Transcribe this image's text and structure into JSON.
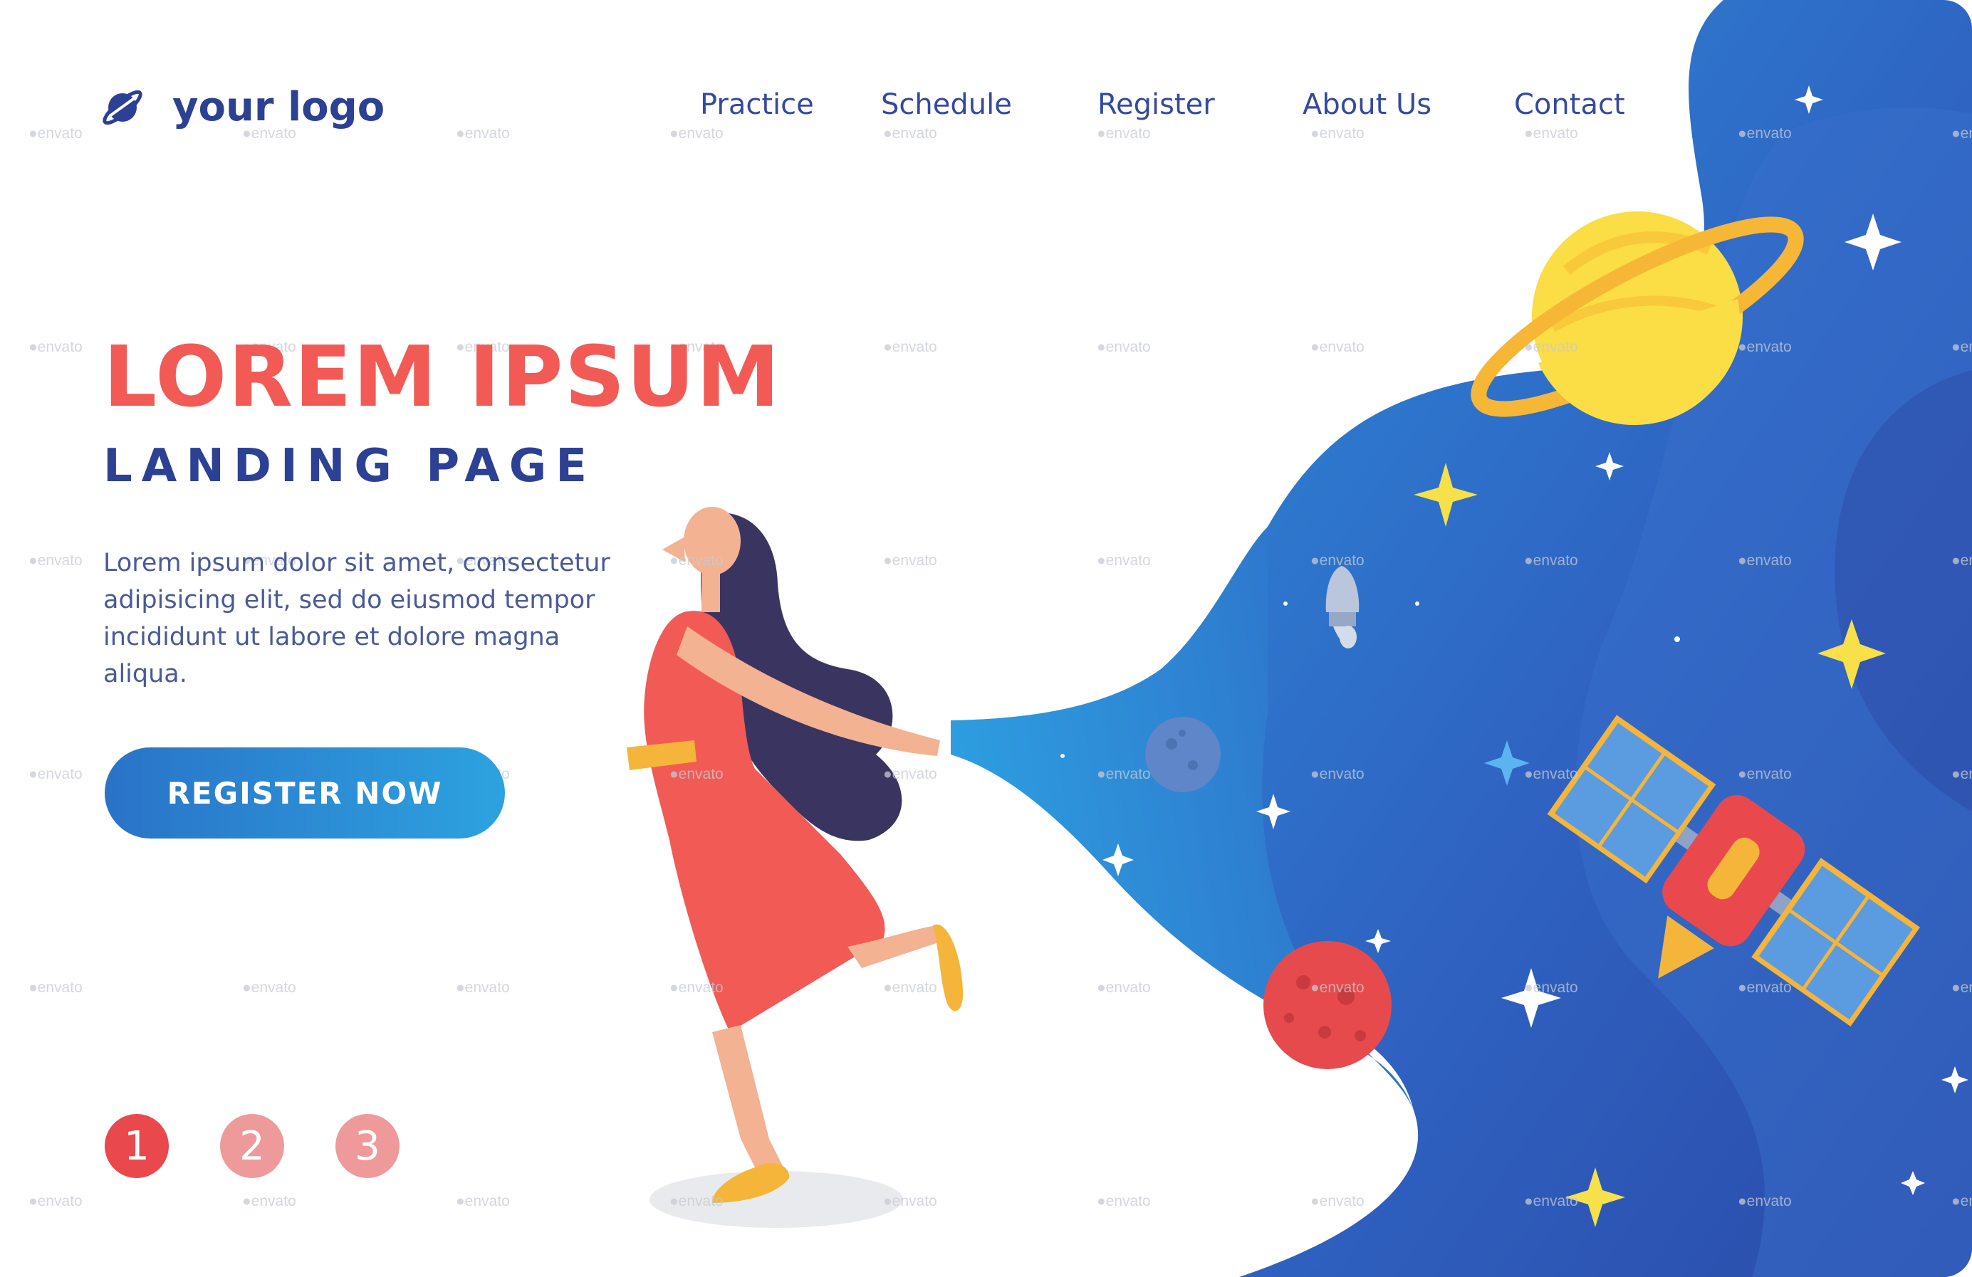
{
  "logo": {
    "text": "your logo",
    "icon": "planet-ring-icon"
  },
  "nav": {
    "items": [
      {
        "label": "Practice"
      },
      {
        "label": "Schedule"
      },
      {
        "label": "Register"
      },
      {
        "label": "About Us"
      },
      {
        "label": "Contact"
      }
    ]
  },
  "hero": {
    "title": "LOREM IPSUM",
    "subtitle": "LANDING PAGE",
    "body": "Lorem ipsum dolor sit amet, consectetur adipisicing elit, sed do eiusmod tempor incididunt ut labore et dolore magna aliqua.",
    "cta_label": "REGISTER NOW"
  },
  "pagination": {
    "pages": [
      "1",
      "2",
      "3"
    ],
    "active": "1"
  },
  "watermark": {
    "text": "envato"
  },
  "colors": {
    "accent_red": "#f25a55",
    "brand_blue": "#2c4193",
    "space_blue": "#2e6cc8",
    "button_gradient_start": "#2a73c8",
    "button_gradient_end": "#2da2df"
  },
  "illustration": {
    "elements": [
      "woman-icon",
      "space-blanket",
      "saturn-icon",
      "satellite-icon",
      "rocket-icon",
      "moon-icon",
      "mars-icon",
      "star-icon"
    ]
  }
}
